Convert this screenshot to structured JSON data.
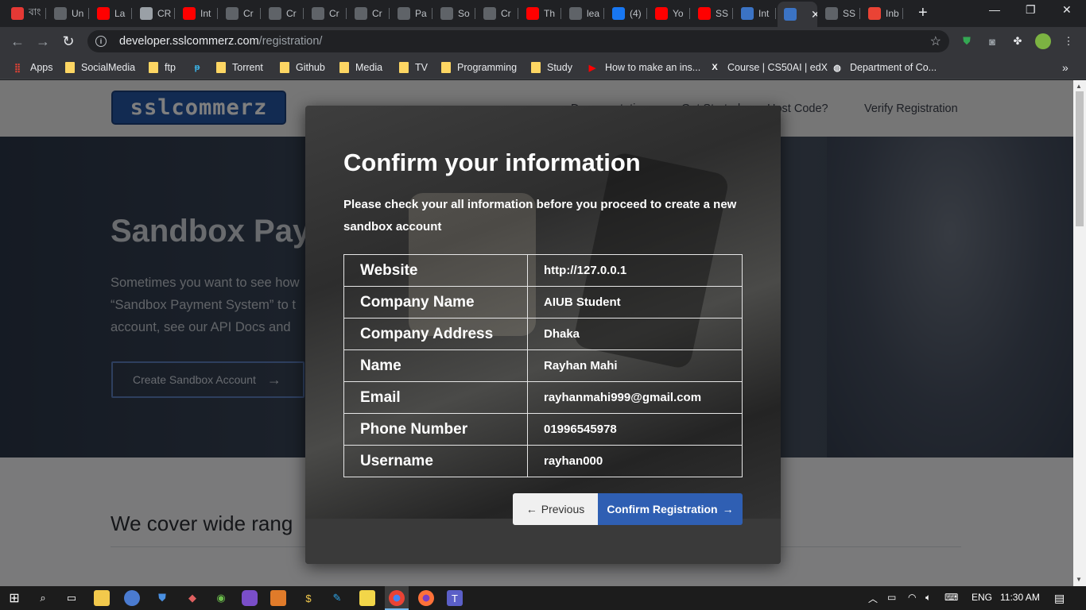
{
  "browser": {
    "tabs": [
      {
        "title": "বাং",
        "icon": "red-circle-icon",
        "color": "#e53935"
      },
      {
        "title": "Un",
        "icon": "grid-icon",
        "color": "#5f6368"
      },
      {
        "title": "La",
        "icon": "youtube-icon",
        "color": "#ff0000"
      },
      {
        "title": "CR",
        "icon": "trello-icon",
        "color": "#9aa0a6"
      },
      {
        "title": "Int",
        "icon": "youtube-icon",
        "color": "#ff0000"
      },
      {
        "title": "Cr",
        "icon": "github-icon",
        "color": "#5f6368"
      },
      {
        "title": "Cr",
        "icon": "github-icon",
        "color": "#5f6368"
      },
      {
        "title": "Cr",
        "icon": "github-icon",
        "color": "#5f6368"
      },
      {
        "title": "Cr",
        "icon": "github-icon",
        "color": "#5f6368"
      },
      {
        "title": "Pa",
        "icon": "github-icon",
        "color": "#5f6368"
      },
      {
        "title": "So",
        "icon": "github-icon",
        "color": "#5f6368"
      },
      {
        "title": "Cr",
        "icon": "github-icon",
        "color": "#5f6368"
      },
      {
        "title": "Th",
        "icon": "youtube-icon",
        "color": "#ff0000"
      },
      {
        "title": "lea",
        "icon": "page-icon",
        "color": "#5f6368"
      },
      {
        "title": "(4)",
        "icon": "facebook-icon",
        "color": "#1877f2"
      },
      {
        "title": "Yo",
        "icon": "youtube-icon",
        "color": "#ff0000"
      },
      {
        "title": "SS",
        "icon": "youtube-icon",
        "color": "#ff0000"
      },
      {
        "title": "Int",
        "icon": "zoom-icon",
        "color": "#3b73c4"
      },
      {
        "title": "",
        "icon": "zoom-icon",
        "color": "#3b73c4",
        "active": true
      },
      {
        "title": "SS",
        "icon": "github-icon",
        "color": "#5f6368"
      },
      {
        "title": "Inb",
        "icon": "gmail-icon",
        "color": "#ea4335"
      }
    ],
    "url_host": "developer.sslcommerz.com",
    "url_path": "/registration/",
    "bookmarks": [
      {
        "label": "Apps",
        "icon": "apps-grid-icon"
      },
      {
        "label": "SocialMedia",
        "icon": "folder-icon"
      },
      {
        "label": "ftp",
        "icon": "folder-icon"
      },
      {
        "label": "",
        "icon": "p-logo-icon"
      },
      {
        "label": "Torrent",
        "icon": "folder-icon"
      },
      {
        "label": "Github",
        "icon": "folder-icon"
      },
      {
        "label": "Media",
        "icon": "folder-icon"
      },
      {
        "label": "TV",
        "icon": "folder-icon"
      },
      {
        "label": "Programming",
        "icon": "folder-icon"
      },
      {
        "label": "Study",
        "icon": "folder-icon"
      },
      {
        "label": "How to make an ins...",
        "icon": "youtube-icon"
      },
      {
        "label": "Course | CS50AI | edX",
        "icon": "edx-icon"
      },
      {
        "label": "Department of Co...",
        "icon": "globe-icon"
      }
    ]
  },
  "site": {
    "logo": "sslcommerz",
    "nav": [
      "Documentation",
      "Get Started",
      "Host Code?",
      "Verify Registration"
    ],
    "hero_title": "Sandbox Pay",
    "hero_lines": [
      "Sometimes you want to see how",
      "“Sandbox Payment System” to t",
      "account, see our API Docs and"
    ],
    "hero_button": "Create Sandbox Account",
    "lower_title": "We cover wide rang"
  },
  "modal": {
    "title": "Confirm your information",
    "subtitle": "Please check your all information before you proceed to create a new sandbox account",
    "rows": [
      {
        "label": "Website",
        "value": "http://127.0.0.1"
      },
      {
        "label": "Company Name",
        "value": "AIUB Student"
      },
      {
        "label": "Company Address",
        "value": "Dhaka"
      },
      {
        "label": "Name",
        "value": "Rayhan Mahi"
      },
      {
        "label": "Email",
        "value": "rayhanmahi999@gmail.com"
      },
      {
        "label": "Phone Number",
        "value": "01996545978"
      },
      {
        "label": "Username",
        "value": "rayhan000"
      }
    ],
    "prev_label": "Previous",
    "confirm_label": "Confirm Registration"
  },
  "taskbar": {
    "language": "ENG",
    "time": "11:30 AM"
  },
  "colors": {
    "accent": "#2f5fb3",
    "brand": "#2457a4"
  }
}
